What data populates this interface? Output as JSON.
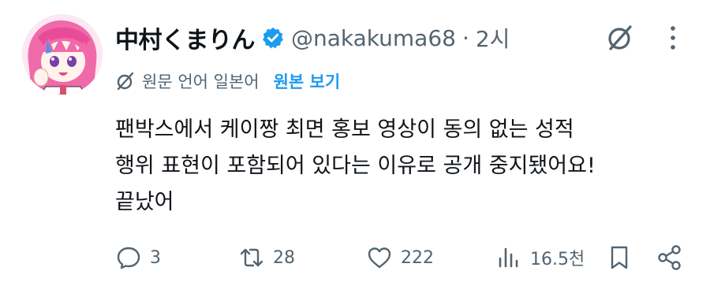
{
  "tweet": {
    "display_name": "中村くまりん",
    "handle": "@nakakuma68",
    "separator": "·",
    "time": "2시",
    "translation": {
      "source_language": "원문 언어 일본어",
      "show_original": "원본 보기"
    },
    "text_lines": [
      "팬박스에서 케이짱 최면 홍보 영상이 동의 없는 성적",
      "행위 표현이 포함되어 있다는 이유로 공개 중지됐어요!",
      "끝났어"
    ]
  },
  "actions": {
    "reply_count": "3",
    "retweet_count": "28",
    "like_count": "222",
    "views_count": "16.5천"
  },
  "colors": {
    "text": "#0f1419",
    "secondary": "#536471",
    "accent": "#1d9bf0"
  },
  "icons": [
    "grok-icon",
    "more-icon",
    "translate-icon",
    "verified-badge-icon",
    "reply-icon",
    "retweet-icon",
    "like-icon",
    "views-icon",
    "bookmark-icon",
    "share-icon"
  ]
}
